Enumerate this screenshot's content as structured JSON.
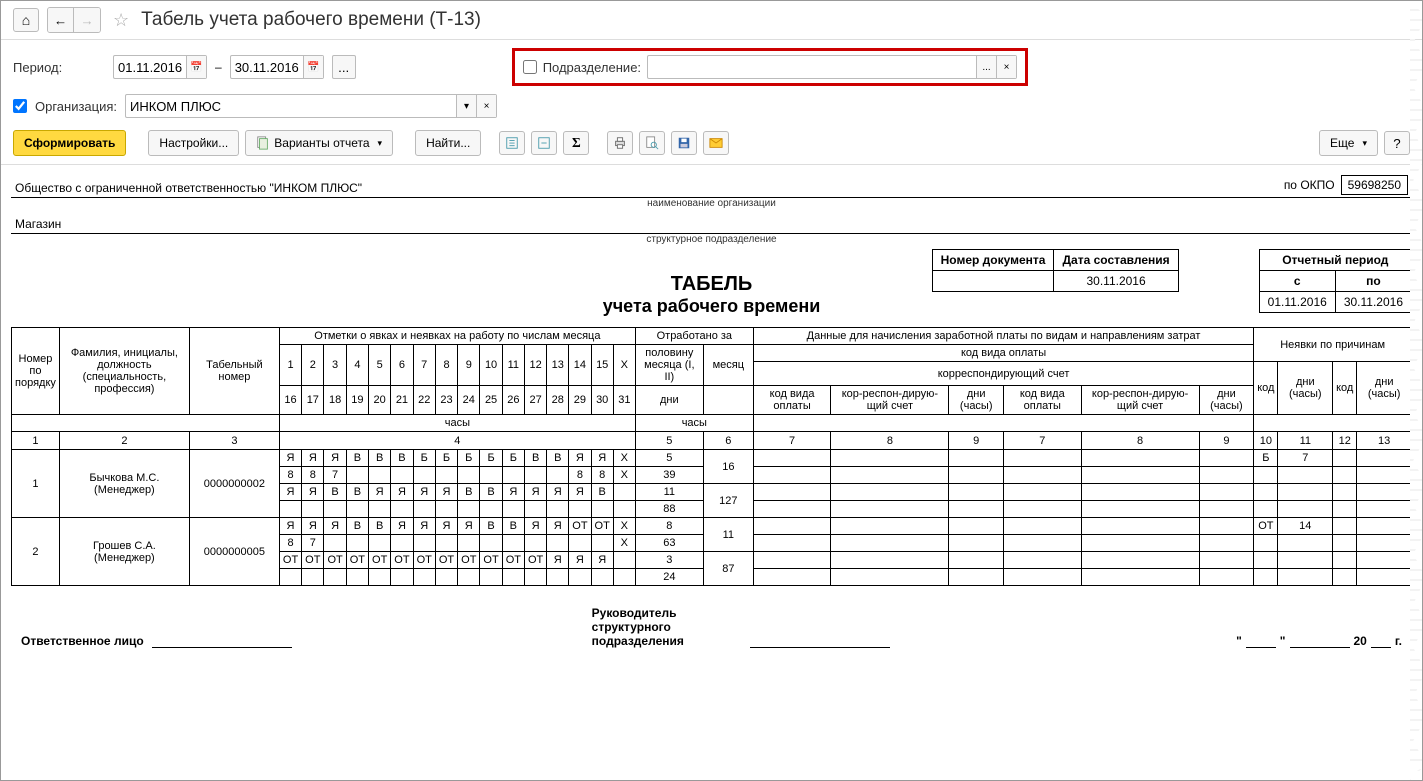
{
  "title": "Табель учета рабочего времени (Т-13)",
  "nav": {
    "home": "⌂",
    "back": "←",
    "fwd": "→",
    "star": "☆"
  },
  "filters": {
    "period_label": "Период:",
    "date_from": "01.11.2016",
    "dash": "–",
    "date_to": "30.11.2016",
    "ellipsis": "...",
    "subdiv_label": "Подразделение:",
    "subdiv_value": "",
    "org_chk": true,
    "org_label": "Организация:",
    "org_value": "ИНКОМ ПЛЮС"
  },
  "actions": {
    "generate": "Сформировать",
    "settings": "Настройки...",
    "variants": "Варианты отчета",
    "find": "Найти...",
    "more": "Еще",
    "help": "?"
  },
  "report": {
    "org_full": "Общество с ограниченной ответственностью \"ИНКОМ ПЛЮС\"",
    "okpo_label": "по ОКПО",
    "okpo": "59698250",
    "org_caption": "наименование организации",
    "unit": "Магазин",
    "unit_caption": "структурное подразделение",
    "doc_num_h": "Номер документа",
    "doc_date_h": "Дата составления",
    "doc_num": "",
    "doc_date": "30.11.2016",
    "rep_period_h": "Отчетный период",
    "rep_from_h": "с",
    "rep_to_h": "по",
    "rep_from": "01.11.2016",
    "rep_to": "30.11.2016",
    "title1": "ТАБЕЛЬ",
    "title2": "учета  рабочего времени",
    "columns": {
      "c1": "Номер по порядку",
      "c2": "Фамилия, инициалы, должность (специальность, профессия)",
      "c3": "Табельный номер",
      "c4h": "Отметки о явках и неявках на работу по числам месяца",
      "c5h": "Отработано за",
      "c5a": "половину месяца (I, II)",
      "c5b": "месяц",
      "c5c": "дни",
      "c5d": "часы",
      "c6h": "Данные для начисления заработной платы по видам и направлениям затрат",
      "c6a": "код вида оплаты",
      "c6b": "корреспондирующий счет",
      "c6c": "код вида оплаты",
      "c6d": "кор-респон-дирую-щий счет",
      "c6e": "дни (часы)",
      "c7h": "Неявки по причинам",
      "c7a": "код",
      "c7b": "дни (часы)",
      "row_nums": [
        "1",
        "2",
        "3",
        "4",
        "5",
        "6",
        "7",
        "8",
        "9",
        "10",
        "11",
        "12",
        "13"
      ]
    },
    "days_r1": [
      "1",
      "2",
      "3",
      "4",
      "5",
      "6",
      "7",
      "8",
      "9",
      "10",
      "11",
      "12",
      "13",
      "14",
      "15",
      "X"
    ],
    "days_r2": [
      "16",
      "17",
      "18",
      "19",
      "20",
      "21",
      "22",
      "23",
      "24",
      "25",
      "26",
      "27",
      "28",
      "29",
      "30",
      "31"
    ],
    "rows": [
      {
        "n": "1",
        "name": "Бычкова М.С. (Менеджер)",
        "tab": "0000000002",
        "l1": [
          "Я",
          "Я",
          "Я",
          "В",
          "В",
          "В",
          "Б",
          "Б",
          "Б",
          "Б",
          "Б",
          "В",
          "В",
          "Я",
          "Я",
          "X"
        ],
        "l2": [
          "8",
          "8",
          "7",
          "",
          "",
          "",
          "",
          "",
          "",
          "",
          "",
          "",
          "",
          "8",
          "8",
          "X"
        ],
        "l3": [
          "Я",
          "Я",
          "В",
          "В",
          "Я",
          "Я",
          "Я",
          "Я",
          "В",
          "В",
          "Я",
          "Я",
          "Я",
          "Я",
          "В",
          ""
        ],
        "l4": [
          "",
          "",
          "",
          "",
          "",
          "",
          "",
          "",
          "",
          "",
          "",
          "",
          "",
          "",
          "",
          ""
        ],
        "half_days": [
          "5",
          "39",
          "11",
          "88"
        ],
        "month_days": "16",
        "month_hours": "127",
        "abs_code": "Б",
        "abs_days": "7"
      },
      {
        "n": "2",
        "name": "Грошев  С.А. (Менеджер)",
        "tab": "0000000005",
        "l1": [
          "Я",
          "Я",
          "Я",
          "В",
          "В",
          "Я",
          "Я",
          "Я",
          "Я",
          "В",
          "В",
          "Я",
          "Я",
          "ОТ",
          "ОТ",
          "X"
        ],
        "l2": [
          "8",
          "7",
          "",
          "",
          "",
          "",
          "",
          "",
          "",
          "",
          "",
          "",
          "",
          "",
          "",
          "X"
        ],
        "l3": [
          "ОТ",
          "ОТ",
          "ОТ",
          "ОТ",
          "ОТ",
          "ОТ",
          "ОТ",
          "ОТ",
          "ОТ",
          "ОТ",
          "ОТ",
          "ОТ",
          "Я",
          "Я",
          "Я",
          ""
        ],
        "l4": [
          "",
          "",
          "",
          "",
          "",
          "",
          "",
          "",
          "",
          "",
          "",
          "",
          "",
          "",
          "",
          ""
        ],
        "half_days": [
          "8",
          "63",
          "3",
          "24"
        ],
        "month_days": "11",
        "month_hours": "87",
        "abs_code": "ОТ",
        "abs_days": "14"
      }
    ],
    "footer": {
      "resp": "Ответственное лицо",
      "head": "Руководитель структурного подразделения",
      "year_suffix": "20",
      "year_g": "г."
    }
  }
}
